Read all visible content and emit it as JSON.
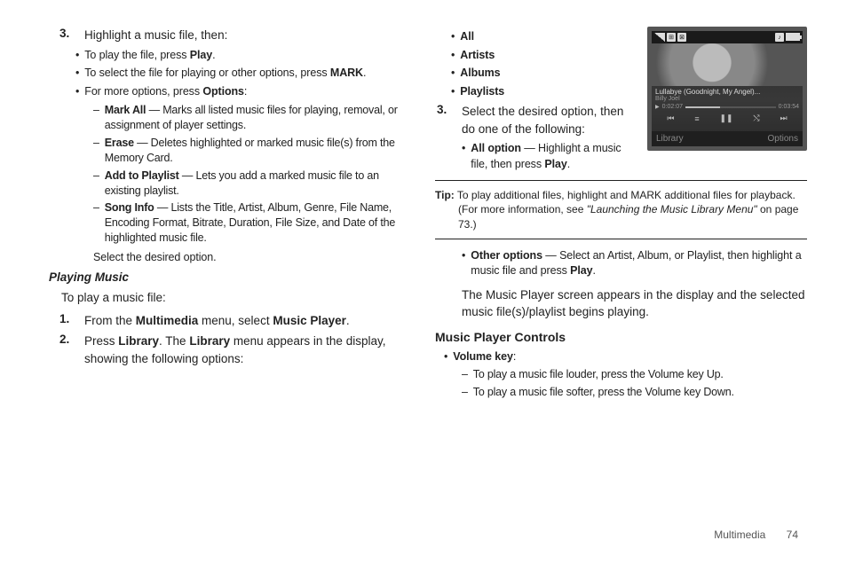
{
  "left": {
    "step3_num": "3.",
    "step3_text_a": "Highlight a music file, then:",
    "b1_a": "To play the file, press ",
    "b1_b": "Play",
    "b1_c": ".",
    "b2_a": "To select the file for playing or other options, press ",
    "b2_b": "MARK",
    "b2_c": ".",
    "b3_a": "For more options, press ",
    "b3_b": "Options",
    "b3_c": ":",
    "d1_a": "Mark All",
    "d1_b": " — Marks all listed music files for playing, removal, or assignment of player settings.",
    "d2_a": "Erase",
    "d2_b": " — Deletes highlighted or marked music file(s) from the Memory Card.",
    "d3_a": "Add to Playlist",
    "d3_b": " — Lets you add a marked music file to an existing playlist.",
    "d4_a": "Song Info",
    "d4_b": " — Lists the Title, Artist, Album, Genre, File Name, Encoding Format, Bitrate, Duration, File Size, and Date of the highlighted music file.",
    "select_desired": "Select the desired option.",
    "playing_music": "Playing Music",
    "to_play": "To play a music file:",
    "s1_num": "1.",
    "s1_a": "From the ",
    "s1_b": "Multimedia",
    "s1_c": " menu, select ",
    "s1_d": "Music Player",
    "s1_e": ".",
    "s2_num": "2.",
    "s2_a": "Press ",
    "s2_b": "Library",
    "s2_c": ". The ",
    "s2_d": "Library",
    "s2_e": " menu appears in the display, showing the following options:"
  },
  "right": {
    "opts": {
      "all": "All",
      "artists": "Artists",
      "albums": "Albums",
      "playlists": "Playlists"
    },
    "s3_num": "3.",
    "s3_text": "Select the desired option, then do one of the following:",
    "allopt_a": "All option",
    "allopt_b": " — Highlight a music file, then press ",
    "allopt_c": "Play",
    "allopt_d": ".",
    "tip_label": "Tip:",
    "tip_a": " To play additional files, highlight and MARK additional files for playback. (For more information, see ",
    "tip_b": "\"Launching the Music Library Menu\"",
    "tip_c": " on page 73.)",
    "other_a": "Other options",
    "other_b": " — Select an Artist, Album, or Playlist, then highlight a music file and press ",
    "other_c": "Play",
    "other_d": ".",
    "appears": "The Music Player screen appears in the display and the selected music file(s)/playlist begins playing.",
    "controls_heading": "Music Player Controls",
    "vol_label": "Volume key",
    "vol_colon": ":",
    "vd1": "To play a music file louder, press the Volume key Up.",
    "vd2": "To play a music file softer, press the Volume key Down.",
    "screenshot": {
      "title": "Lullabye (Goodnight, My Angel)...",
      "artist": "Billy Joel",
      "t1": "0:02:07",
      "t2": "0:03:54",
      "soft_left": "Library",
      "soft_right": "Options"
    }
  },
  "footer": {
    "section": "Multimedia",
    "page": "74"
  }
}
